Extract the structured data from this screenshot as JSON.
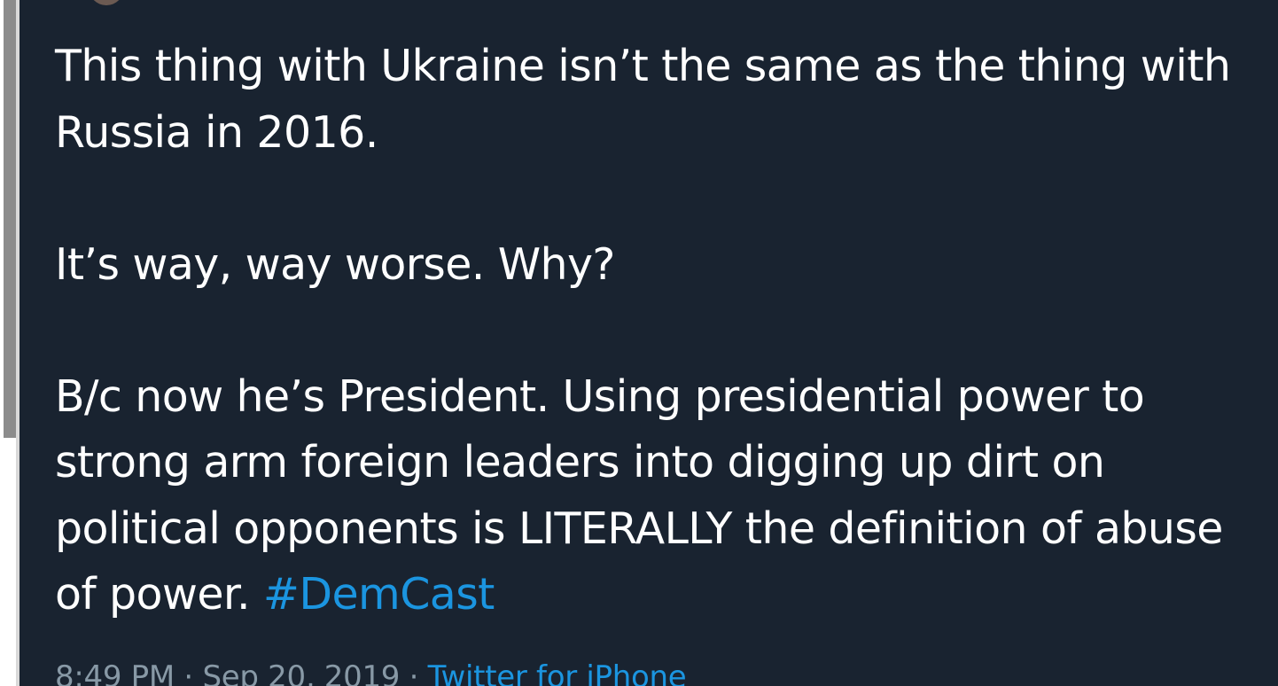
{
  "tweet": {
    "lines": [
      "This thing with Ukraine isn’t the same as the thing with",
      "Russia in 2016.",
      "",
      "It’s way, way worse. Why?",
      "",
      "B/c now he’s President. Using presidential power to",
      "strong arm foreign leaders into digging up dirt on",
      "political opponents is LITERALLY the definition of abuse",
      "of power. "
    ],
    "hashtag": "#DemCast"
  },
  "meta": {
    "time": "8:49 PM",
    "separator": " · ",
    "date": "Sep 20, 2019",
    "source": "Twitter for iPhone"
  },
  "colors": {
    "background": "#192330",
    "text": "#ffffff",
    "link": "#1b95e0",
    "muted": "#8899a6"
  }
}
